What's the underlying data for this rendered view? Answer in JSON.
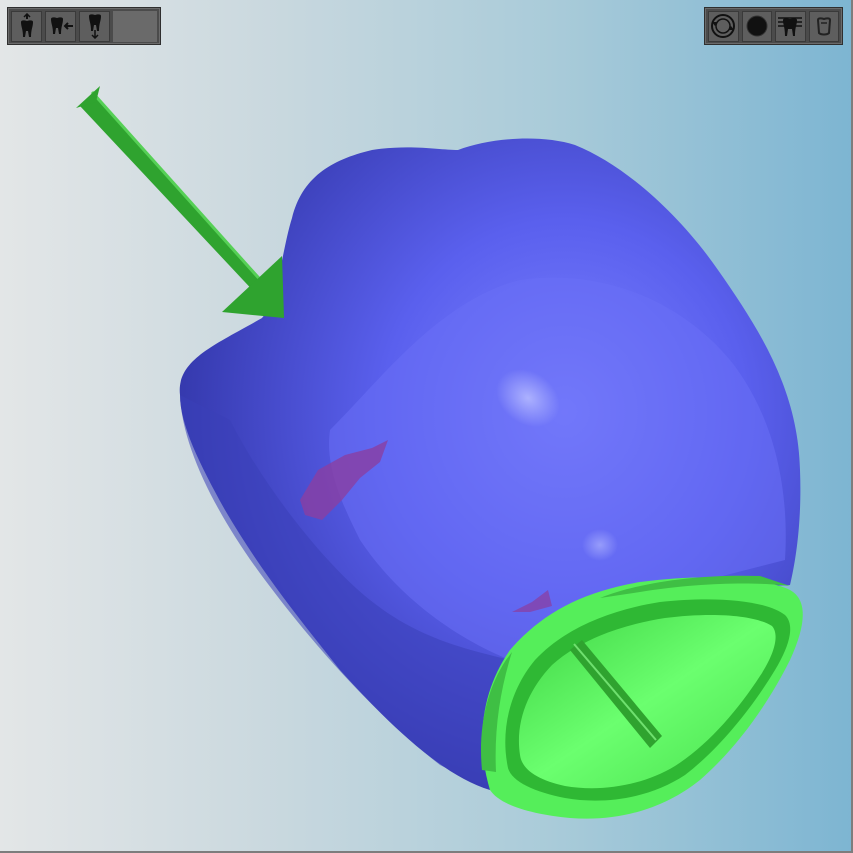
{
  "viewport": {
    "background_left": "#e3e6e7",
    "background_right": "#7db5d2"
  },
  "model": {
    "crown_color": "#4f55e6",
    "margin_color": "#55f05a",
    "arrow_color": "#2fa32f",
    "contact_color": "#8a3fa3"
  },
  "toolbar_left": {
    "buttons": [
      {
        "icon": "tooth-insertion-axis-icon"
      },
      {
        "icon": "tooth-arrow-left-icon"
      },
      {
        "icon": "tooth-move-vertical-icon"
      }
    ]
  },
  "toolbar_right": {
    "buttons": [
      {
        "icon": "rotate-view-icon"
      },
      {
        "icon": "sphere-icon"
      },
      {
        "icon": "dental-arch-icon"
      },
      {
        "icon": "crown-icon"
      }
    ]
  }
}
